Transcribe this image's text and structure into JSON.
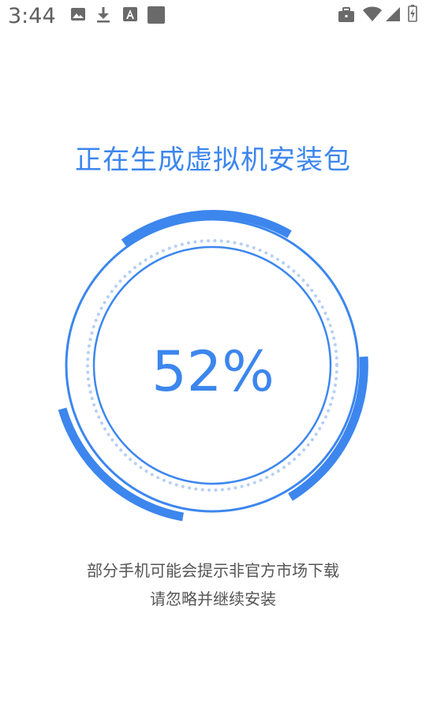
{
  "status_bar": {
    "time": "3:44",
    "left_icons": [
      "image-icon",
      "download-icon",
      "font-a-icon",
      "square-notification-icon"
    ],
    "right_icons": [
      "briefcase-icon",
      "wifi-icon",
      "signal-icon",
      "battery-icon"
    ]
  },
  "main": {
    "title": "正在生成虚拟机安装包",
    "progress": {
      "value": 0.52,
      "label": "52%"
    },
    "hint_line1": "部分手机可能会提示非官方市场下载",
    "hint_line2": "请忽略并继续安装"
  },
  "colors": {
    "accent": "#3c86ee",
    "accent_light": "#b7cff5",
    "hint_text": "#555555",
    "status_icon": "#6a6a6a"
  }
}
